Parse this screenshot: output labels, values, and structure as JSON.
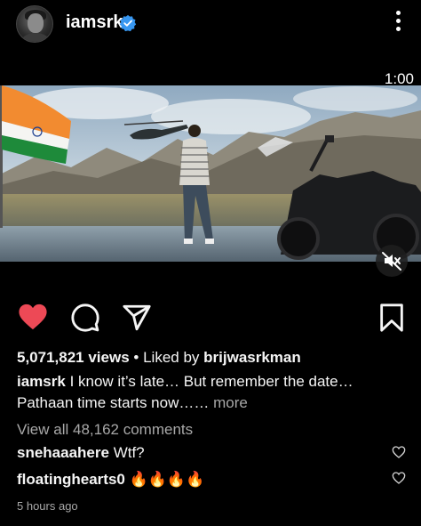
{
  "header": {
    "username": "iamsrk",
    "avatar": "profile-avatar",
    "verified_icon": "verified-badge-icon",
    "more_icon": "more-vertical-icon"
  },
  "video": {
    "timer": "1:00",
    "mute_icon": "muted-speaker-icon",
    "status": "muted"
  },
  "actions": {
    "like_icon": "heart-filled-icon",
    "comment_icon": "comment-icon",
    "share_icon": "send-icon",
    "save_icon": "bookmark-icon",
    "like_color": "#ed4956"
  },
  "stats": {
    "views": "5,071,821 views",
    "separator": "•",
    "liked_by_prefix": "Liked by",
    "liked_by_user": "brijwasrkman"
  },
  "caption": {
    "author": "iamsrk",
    "line1": "I know it’s late… But remember the date…",
    "line2": "Pathaan time starts now……",
    "more": "more"
  },
  "comments": {
    "view_all": "View all 48,162 comments",
    "items": [
      {
        "user": "snehaaahere",
        "text": "Wtf?",
        "like_icon": "heart-outline-icon"
      },
      {
        "user": "floatinghearts0",
        "text": "🔥🔥🔥🔥",
        "like_icon": "heart-outline-icon"
      }
    ]
  },
  "timestamp": "5 hours ago",
  "colors": {
    "background": "#000000",
    "text": "#f5f5f5",
    "muted_text": "#a8a8a8",
    "verified_blue": "#3897f0",
    "like_red": "#ed4956"
  }
}
